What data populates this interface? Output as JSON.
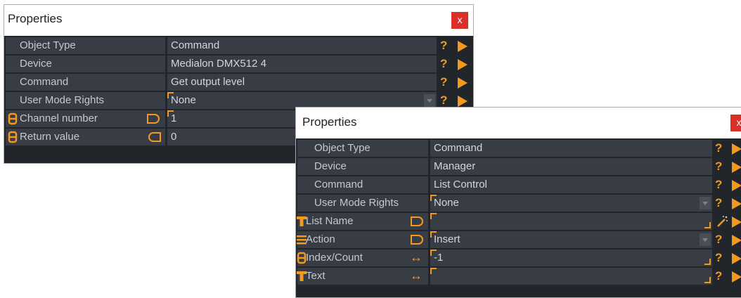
{
  "colors": {
    "accent": "#f39a1e",
    "panel_bg": "#22262b",
    "cell_bg": "#383c44",
    "close_bg": "#d9302a"
  },
  "panel1": {
    "title": "Properties",
    "close_label": "x",
    "rows": [
      {
        "name": "Object Type",
        "value": "Command"
      },
      {
        "name": "Device",
        "value": "Medialon DMX512 4"
      },
      {
        "name": "Command",
        "value": "Get output level"
      },
      {
        "name": "User Mode Rights",
        "value": "None"
      },
      {
        "name": "Channel number",
        "value": "1",
        "icon": "numeric-variable-icon"
      },
      {
        "name": "Return value",
        "value": "0",
        "icon": "numeric-variable-icon"
      }
    ]
  },
  "panel2": {
    "title": "Properties",
    "close_label": "x",
    "rows": [
      {
        "name": "Object Type",
        "value": "Command"
      },
      {
        "name": "Device",
        "value": "Manager"
      },
      {
        "name": "Command",
        "value": "List Control"
      },
      {
        "name": "User Mode Rights",
        "value": "None"
      },
      {
        "name": "List Name",
        "value": "",
        "icon": "text-variable-icon"
      },
      {
        "name": "Action",
        "value": "Insert",
        "icon": "enum-variable-icon"
      },
      {
        "name": "Index/Count",
        "value": "-1",
        "icon": "numeric-variable-icon"
      },
      {
        "name": "Text",
        "value": "",
        "icon": "text-variable-icon"
      }
    ]
  }
}
